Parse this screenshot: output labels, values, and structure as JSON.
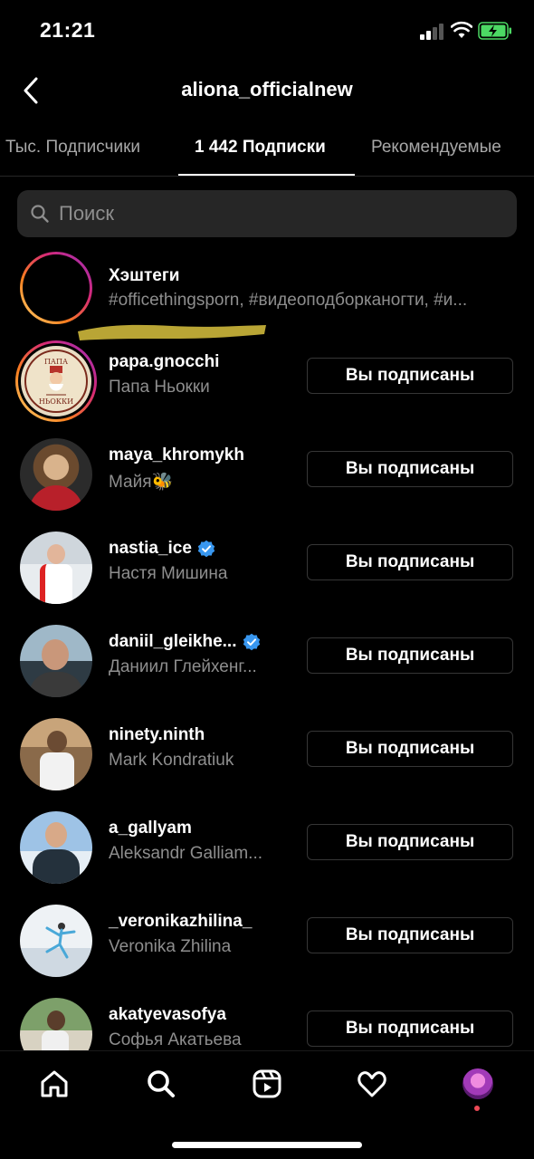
{
  "status_bar": {
    "time": "21:21"
  },
  "nav": {
    "title": "aliona_officialnew"
  },
  "tabs": [
    {
      "label": "Тыс. Подписчики",
      "active": false
    },
    {
      "label": "1 442 Подписки",
      "active": true
    },
    {
      "label": "Рекомендуемые",
      "active": false
    }
  ],
  "search": {
    "placeholder": "Поиск"
  },
  "hashtags": {
    "title": "Хэштеги",
    "subtitle": "#officethingsporn, #видеоподборканогти, #и..."
  },
  "following": [
    {
      "username": "papa.gnocchi",
      "full_name": "Папа Ньокки",
      "verified": false,
      "button": "Вы подписаны",
      "avatar_label": "ПАПА НЬОККИ"
    },
    {
      "username": "maya_khromykh",
      "full_name": "Майя🐝",
      "verified": false,
      "button": "Вы подписаны"
    },
    {
      "username": "nastia_ice",
      "full_name": "Настя Мишина",
      "verified": true,
      "button": "Вы подписаны"
    },
    {
      "username": "daniil_gleikhe...",
      "full_name": "Даниил Глейхенг...",
      "verified": true,
      "button": "Вы подписаны"
    },
    {
      "username": "ninety.ninth",
      "full_name": "Mark Kondratiuk",
      "verified": false,
      "button": "Вы подписаны"
    },
    {
      "username": "a_gallyam",
      "full_name": "Aleksandr Galliam...",
      "verified": false,
      "button": "Вы подписаны"
    },
    {
      "username": "_veronikazhilina_",
      "full_name": "Veronika Zhilina",
      "verified": false,
      "button": "Вы подписаны"
    },
    {
      "username": "akatyevasofya",
      "full_name": "Софья Акатьева",
      "verified": false,
      "button": "Вы подписаны"
    }
  ],
  "colors": {
    "background": "#000000",
    "secondary_text": "#8e8e8e",
    "verified": "#3897f0",
    "search_bg": "#262626",
    "notification_dot": "#ed4956"
  },
  "bottom_nav": [
    "home-icon",
    "search-icon",
    "reels-icon",
    "heart-icon",
    "profile-avatar"
  ]
}
